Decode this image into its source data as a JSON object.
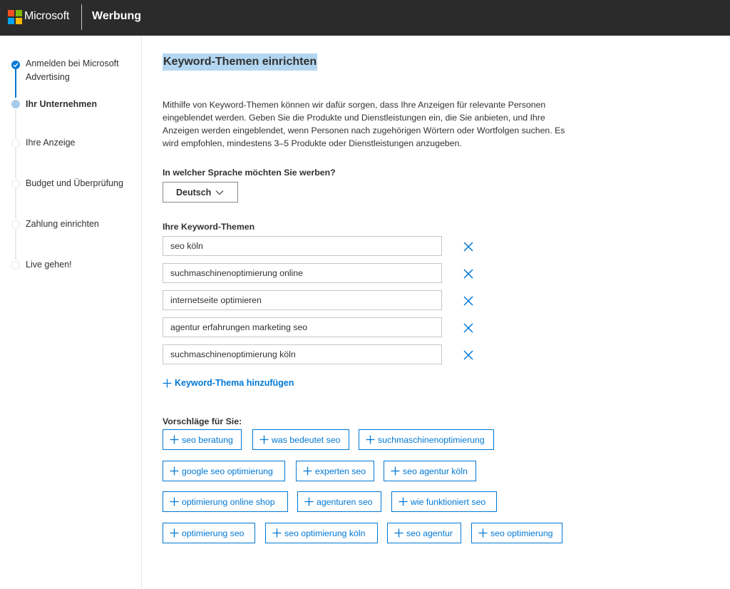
{
  "header": {
    "brand": "Microsoft",
    "product": "Werbung",
    "logo_colors": [
      "#f25022",
      "#7fba00",
      "#00a4ef",
      "#ffb900"
    ]
  },
  "sidebar": {
    "steps": [
      {
        "label": "Anmelden bei Microsoft Advertising",
        "state": "done"
      },
      {
        "label": "Ihr Unternehmen",
        "state": "current"
      },
      {
        "label": "Ihre Anzeige",
        "state": "pending"
      },
      {
        "label": "Budget und Überprüfung",
        "state": "pending"
      },
      {
        "label": "Zahlung einrichten",
        "state": "pending"
      },
      {
        "label": "Live gehen!",
        "state": "pending"
      }
    ]
  },
  "main": {
    "title": "Keyword-Themen einrichten",
    "intro": "Mithilfe von Keyword-Themen können wir dafür sorgen, dass Ihre Anzeigen für relevante Personen eingeblendet werden. Geben Sie die Produkte und Dienstleistungen ein, die Sie anbieten, und Ihre Anzeigen werden eingeblendet, wenn Personen nach zugehörigen Wörtern oder Wortfolgen suchen. Es wird empfohlen, mindestens 3–5 Produkte oder Dienstleistungen anzugeben.",
    "language_question": "In welcher Sprache möchten Sie werben?",
    "language_selected": "Deutsch",
    "keywords_label": "Ihre Keyword-Themen",
    "keywords": [
      "seo köln",
      "suchmaschinenoptimierung online",
      "internetseite optimieren",
      "agentur erfahrungen marketing seo",
      "suchmaschinenoptimierung köln"
    ],
    "add_keyword_label": "Keyword-Thema hinzufügen",
    "suggestions_label": "Vorschläge für Sie:",
    "suggestions": [
      "seo beratung",
      "was bedeutet seo",
      "suchmaschinenoptimierung",
      "google seo optimierung",
      "experten seo",
      "seo agentur köln",
      "optimierung online shop",
      "agenturen seo",
      "wie funktioniert seo",
      "optimierung seo",
      "seo optimierung köln",
      "seo agentur",
      "seo optimierung"
    ]
  },
  "colors": {
    "accent": "#0078d4",
    "header_bg": "#2b2b2b",
    "title_highlight": "#b3d7f2"
  },
  "icons": {
    "remove": "close-icon",
    "add": "plus-icon",
    "dropdown": "chevron-down-icon",
    "done_step": "checkmark-icon"
  }
}
